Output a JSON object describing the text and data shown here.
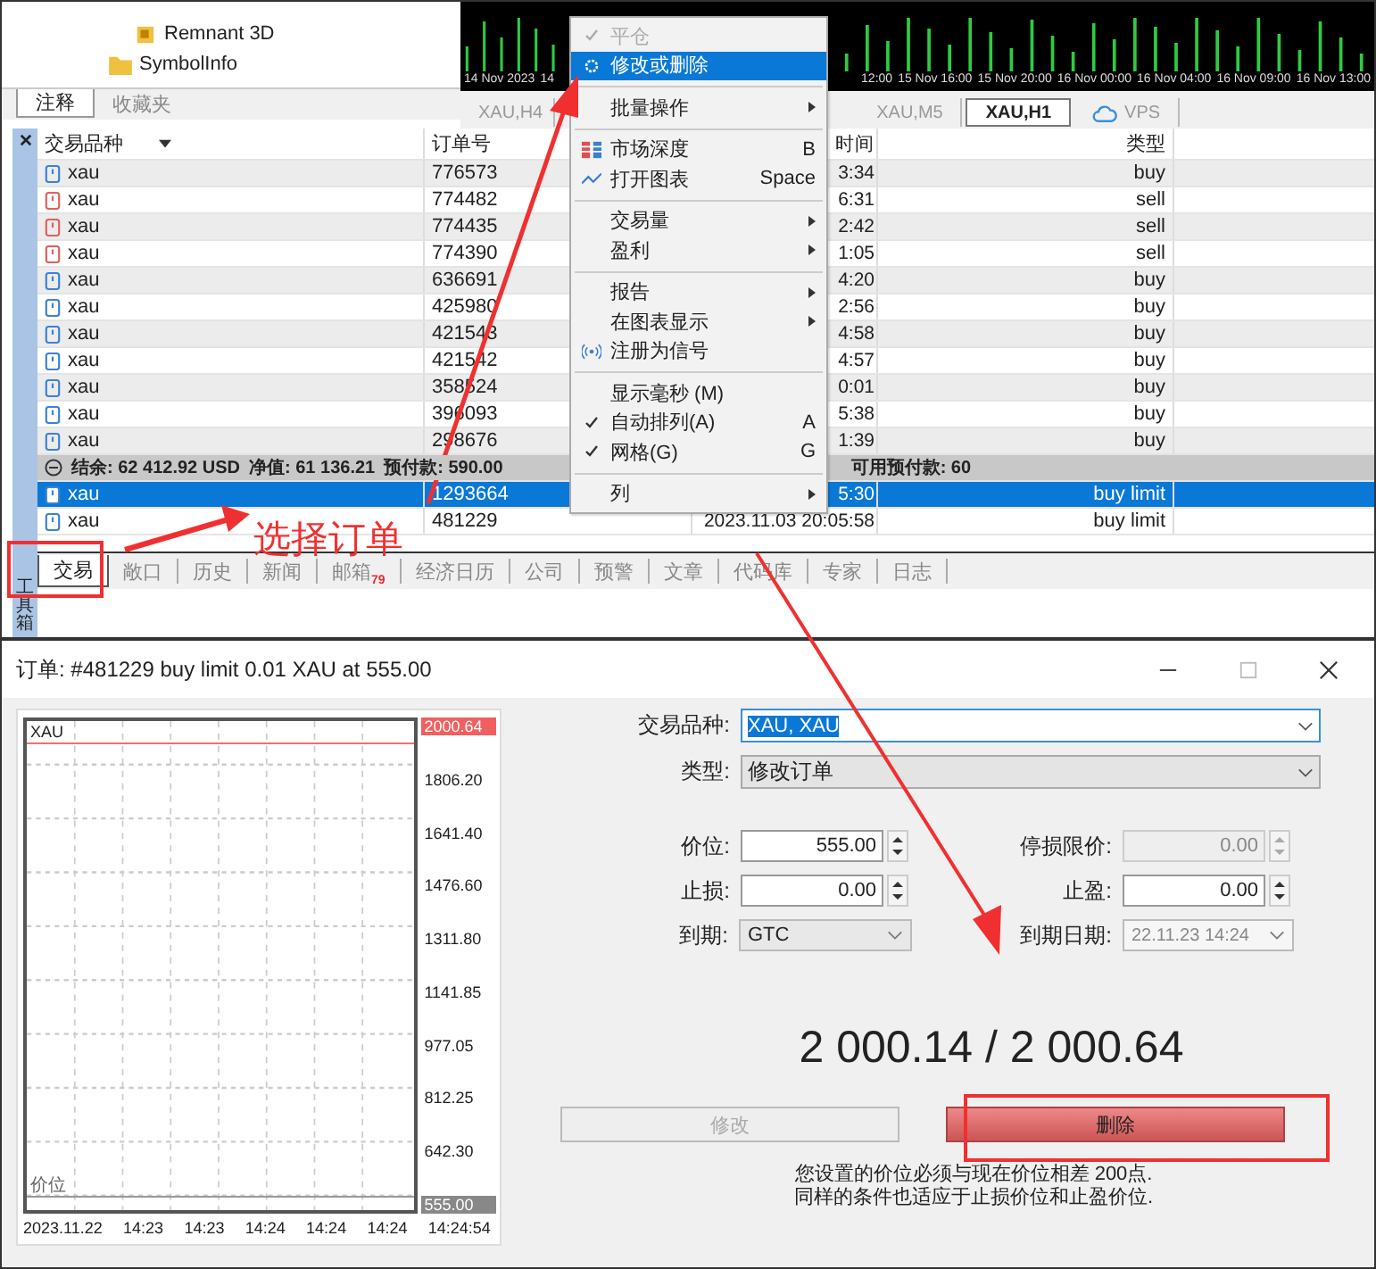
{
  "navigator": {
    "items": [
      {
        "label": "Remnant 3D",
        "kind": "file"
      },
      {
        "label": "SymbolInfo",
        "kind": "folder"
      }
    ],
    "tabs": [
      {
        "label": "注释",
        "selected": true
      },
      {
        "label": "收藏夹",
        "selected": false
      }
    ]
  },
  "chart_strip": {
    "time_labels": [
      "14 Nov 2023",
      "14",
      "12:00",
      "15 Nov 16:00",
      "15 Nov 20:00",
      "16 Nov 00:00",
      "16 Nov 04:00",
      "16 Nov 09:00",
      "16 Nov 13:00"
    ]
  },
  "chart_tabs": [
    {
      "label": "XAU,H4",
      "selected": false,
      "kind": "chart"
    },
    {
      "label": "XAU,M5",
      "selected": false,
      "kind": "chart"
    },
    {
      "label": "XAU,H1",
      "selected": true,
      "kind": "chart"
    },
    {
      "label": "VPS",
      "selected": false,
      "kind": "cloud"
    }
  ],
  "toolbox": {
    "side_label": "工具箱",
    "columns": [
      "交易品种",
      "订单号",
      "时间",
      "类型"
    ],
    "rows": [
      {
        "kind": "order",
        "symbol": "xau",
        "order": "776573",
        "time": "3:34",
        "type": "buy",
        "color": "#3b82d6",
        "selected": false
      },
      {
        "kind": "order",
        "symbol": "xau",
        "order": "774482",
        "time": "6:31",
        "type": "sell",
        "color": "#e0605c",
        "selected": false
      },
      {
        "kind": "order",
        "symbol": "xau",
        "order": "774435",
        "time": "2:42",
        "type": "sell",
        "color": "#e0605c",
        "selected": false
      },
      {
        "kind": "order",
        "symbol": "xau",
        "order": "774390",
        "time": "1:05",
        "type": "sell",
        "color": "#e0605c",
        "selected": false
      },
      {
        "kind": "order",
        "symbol": "xau",
        "order": "636691",
        "time": "4:20",
        "type": "buy",
        "color": "#3b82d6",
        "selected": false
      },
      {
        "kind": "order",
        "symbol": "xau",
        "order": "425980",
        "time": "2:56",
        "type": "buy",
        "color": "#3b82d6",
        "selected": false
      },
      {
        "kind": "order",
        "symbol": "xau",
        "order": "421543",
        "time": "4:58",
        "type": "buy",
        "color": "#3b82d6",
        "selected": false
      },
      {
        "kind": "order",
        "symbol": "xau",
        "order": "421542",
        "time": "4:57",
        "type": "buy",
        "color": "#3b82d6",
        "selected": false
      },
      {
        "kind": "order",
        "symbol": "xau",
        "order": "358524",
        "time": "0:01",
        "type": "buy",
        "color": "#3b82d6",
        "selected": false
      },
      {
        "kind": "order",
        "symbol": "xau",
        "order": "396093",
        "time": "5:38",
        "type": "buy",
        "color": "#3b82d6",
        "selected": false
      },
      {
        "kind": "order",
        "symbol": "xau",
        "order": "298676",
        "time": "1:39",
        "type": "buy",
        "color": "#3b82d6",
        "selected": false
      },
      {
        "kind": "summary",
        "items": [
          "结余: 62 412.92 USD",
          "净值: 61 136.21",
          "预付款: 590.00",
          "可用预付款: 60"
        ]
      },
      {
        "kind": "order",
        "symbol": "xau",
        "order": "1293664",
        "time": "5:30",
        "type": "buy limit",
        "color": "#3b82d6",
        "selected": true
      },
      {
        "kind": "order",
        "symbol": "xau",
        "order": "481229",
        "time": "2023.11.03 20:05:58",
        "type": "buy limit",
        "color": "#3b82d6",
        "selected": false
      }
    ],
    "tabs": [
      {
        "label": "交易",
        "selected": true
      },
      {
        "label": "敞口",
        "selected": false
      },
      {
        "label": "历史",
        "selected": false
      },
      {
        "label": "新闻",
        "selected": false
      },
      {
        "label": "邮箱",
        "badge": "79",
        "selected": false
      },
      {
        "label": "经济日历",
        "selected": false
      },
      {
        "label": "公司",
        "selected": false
      },
      {
        "label": "预警",
        "selected": false
      },
      {
        "label": "文章",
        "selected": false
      },
      {
        "label": "代码库",
        "selected": false
      },
      {
        "label": "专家",
        "selected": false
      },
      {
        "label": "日志",
        "selected": false
      }
    ]
  },
  "context_menu": [
    {
      "kind": "item",
      "label": "平仓",
      "checked": true,
      "disabled": true,
      "selected": false
    },
    {
      "kind": "item",
      "label": "修改或删除",
      "checked": false,
      "disabled": false,
      "selected": true
    },
    {
      "kind": "separator"
    },
    {
      "kind": "item",
      "label": "批量操作",
      "submenu": true,
      "checked": false,
      "disabled": false,
      "selected": false
    },
    {
      "kind": "separator"
    },
    {
      "kind": "item",
      "label": "市场深度",
      "shortcut": "B",
      "checked": false,
      "disabled": false,
      "selected": false
    },
    {
      "kind": "item",
      "label": "打开图表",
      "shortcut": "Space",
      "checked": false,
      "disabled": false,
      "selected": false
    },
    {
      "kind": "separator"
    },
    {
      "kind": "item",
      "label": "交易量",
      "submenu": true,
      "checked": false,
      "disabled": false,
      "selected": false
    },
    {
      "kind": "item",
      "label": "盈利",
      "submenu": true,
      "checked": false,
      "disabled": false,
      "selected": false
    },
    {
      "kind": "separator"
    },
    {
      "kind": "item",
      "label": "报告",
      "submenu": true,
      "checked": false,
      "disabled": false,
      "selected": false
    },
    {
      "kind": "item",
      "label": "在图表显示",
      "submenu": true,
      "checked": false,
      "disabled": false,
      "selected": false
    },
    {
      "kind": "item",
      "label": "注册为信号",
      "checked": false,
      "disabled": false,
      "selected": false
    },
    {
      "kind": "separator"
    },
    {
      "kind": "item",
      "label": "显示毫秒 (M)",
      "checked": false,
      "disabled": false,
      "selected": false
    },
    {
      "kind": "item",
      "label": "自动排列(A)",
      "shortcut": "A",
      "checked": true,
      "disabled": false,
      "selected": false
    },
    {
      "kind": "item",
      "label": "网格(G)",
      "shortcut": "G",
      "checked": true,
      "disabled": false,
      "selected": false
    },
    {
      "kind": "separator"
    },
    {
      "kind": "item",
      "label": "列",
      "submenu": true,
      "checked": false,
      "disabled": false,
      "selected": false
    }
  ],
  "annotation": {
    "text": "选择订单"
  },
  "dialog": {
    "title": "订单: #481229 buy limit 0.01 XAU at 555.00",
    "chart": {
      "symbol": "XAU",
      "price_tag": "2000.64",
      "y_labels": [
        "1806.20",
        "1641.40",
        "1476.60",
        "1311.80",
        "1141.85",
        "977.05",
        "812.25",
        "642.30"
      ],
      "order_label": "价位",
      "order_tag": "555.00",
      "x_labels": [
        "2023.11.22",
        "14:23",
        "14:23",
        "14:24",
        "14:24",
        "14:24",
        "14:24:54"
      ]
    },
    "symbol": {
      "label": "交易品种:",
      "value": "XAU, XAU"
    },
    "type": {
      "label": "类型:",
      "value": "修改订单"
    },
    "fields": [
      {
        "label": "价位:",
        "value": "555.00",
        "kind": "spin",
        "disabled": false
      },
      {
        "label": "停损限价:",
        "value": "0.00",
        "kind": "spin",
        "disabled": true
      },
      {
        "label": "止损:",
        "value": "0.00",
        "kind": "spin",
        "disabled": false
      },
      {
        "label": "止盈:",
        "value": "0.00",
        "kind": "spin",
        "disabled": false
      },
      {
        "label": "到期:",
        "value": "GTC",
        "kind": "select",
        "disabled": false
      },
      {
        "label": "到期日期:",
        "value": "22.11.23 14:24",
        "kind": "select",
        "disabled": true
      }
    ],
    "quote": "2 000.14 / 2 000.64",
    "buttons": [
      {
        "label": "修改",
        "kind": "plain",
        "disabled": true
      },
      {
        "label": "删除",
        "kind": "danger",
        "disabled": false
      }
    ],
    "message": [
      "您设置的价位必须与现在价位相差 200点.",
      "同样的条件也适应于止损价位和止盈价位."
    ]
  }
}
